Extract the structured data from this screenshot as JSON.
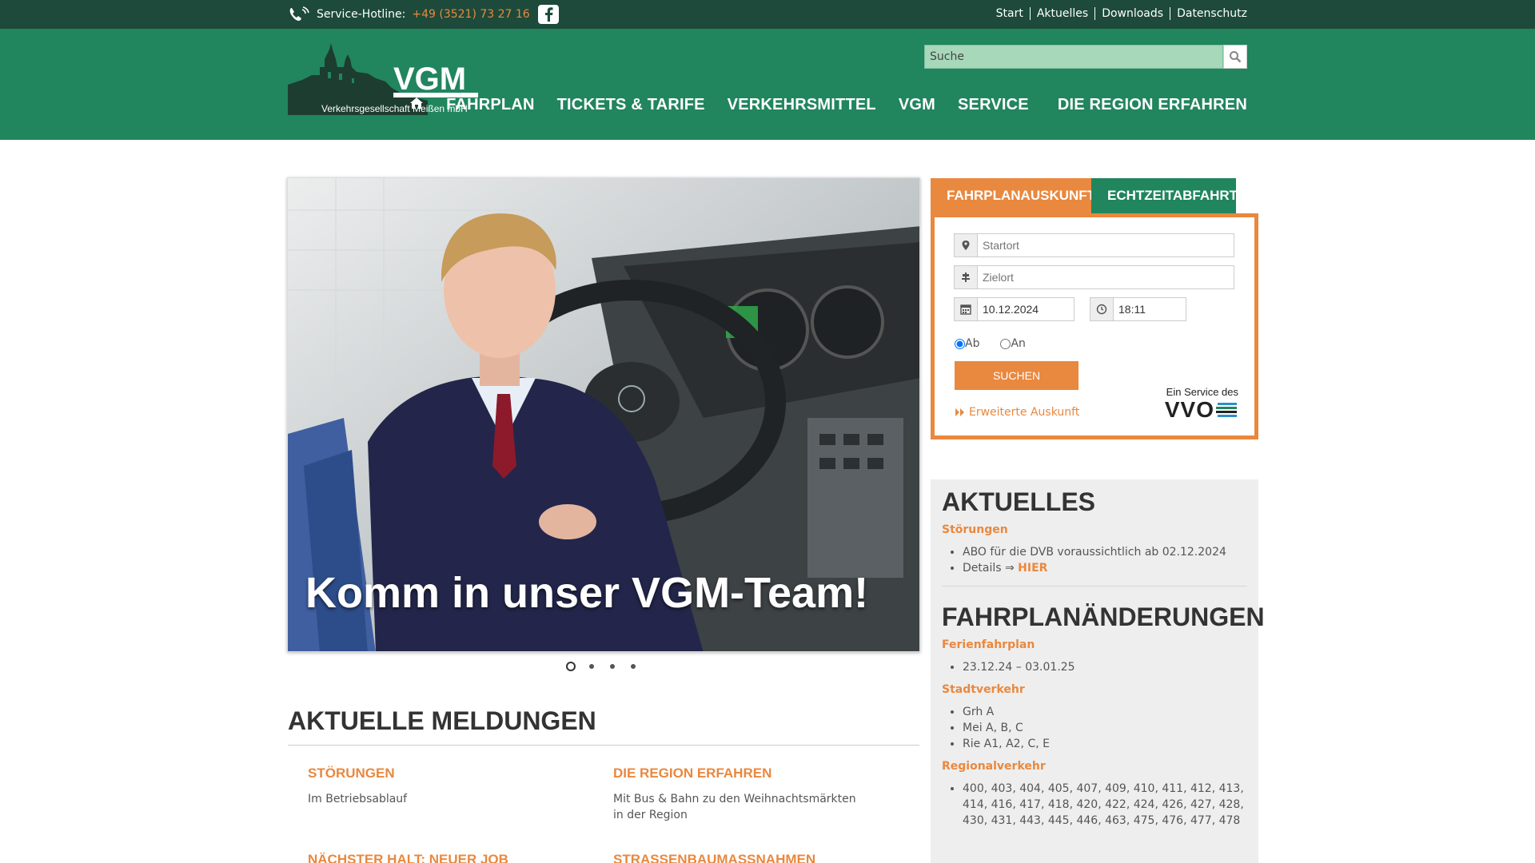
{
  "topbar": {
    "hotline_label": "Service-Hotline:",
    "hotline_number": "+49 (3521) 73 27 16",
    "links": [
      "Start",
      "Aktuelles",
      "Downloads",
      "Datenschutz"
    ]
  },
  "header": {
    "logo_text": "VGM",
    "logo_sub": "Verkehrsgesellschaft Meißen mbH",
    "search_placeholder": "Suche",
    "nav": [
      "Fahrplan",
      "Tickets & Tarife",
      "Verkehrsmittel",
      "VGM",
      "Service",
      "Die Region erfahren"
    ]
  },
  "slider": {
    "caption": "Komm in unser VGM-Team!",
    "slide_count": 4,
    "active_slide": 1
  },
  "meldungen": {
    "title": "Aktuelle Meldungen",
    "items": [
      {
        "title": "Störungen",
        "text": "Im Betriebsablauf"
      },
      {
        "title": "Die Region erfahren",
        "text": "Mit Bus & Bahn zu den Weihnachtsmärkten in der Region"
      },
      {
        "title": "Nächster Halt: Neuer Job",
        "text": ""
      },
      {
        "title": "Straßenbaumaßnahmen",
        "text": ""
      }
    ]
  },
  "planner": {
    "tab_active": "Fahrplanauskunft",
    "tab_other": "Echtzeitabfahrt",
    "start_placeholder": "Startort",
    "ziel_placeholder": "Zielort",
    "date": "10.12.2024",
    "time": "18:11",
    "radio_ab": "Ab",
    "radio_an": "An",
    "submit": "Suchen",
    "advanced": "Erweiterte Auskunft",
    "service_label": "Ein  Service des",
    "service_brand": "VVO"
  },
  "aktuelles": {
    "title": "Aktuelles",
    "stoerungen_title": "Störungen",
    "stoerungen_line1": "ABO für die DVB voraussichtlich ab 02.12.2024",
    "stoerungen_line2": "Details ⇒ ",
    "stoerungen_link": "HIER",
    "fahrplan_title": "Fahrplanänderungen",
    "ferien_title": "Ferienfahrplan",
    "ferien_items": [
      "23.12.24 – 03.01.25"
    ],
    "stadt_title": "Stadtverkehr",
    "stadt_items": [
      "Grh A",
      "Mei A, B, C",
      "Rie A1, A2, C, E"
    ],
    "regional_title": "Regionalverkehr",
    "regional_items": [
      "400, 403, 404, 405, 407, 409, 410, 411, 412, 413, 414, 416, 417, 418, 420, 422, 424, 426, 427, 428, 430, 431, 443, 445, 446, 463, 475, 476, 477, 478"
    ]
  },
  "colors": {
    "topbar": "#1d4a3a",
    "header": "#21855e",
    "accent": "#e9883f",
    "sidebar": "#eeeeee"
  }
}
